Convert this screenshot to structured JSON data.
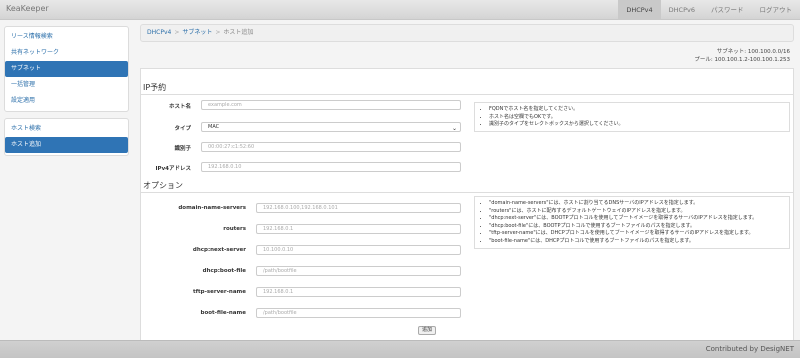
{
  "app": {
    "brand": "KeaKeeper"
  },
  "nav": {
    "items": [
      "DHCPv4",
      "DHCPv6",
      "パスワード",
      "ログアウト"
    ]
  },
  "sidebar": {
    "group1": [
      "リース情報検索",
      "共有ネットワーク",
      "サブネット",
      "一括管理",
      "設定適用"
    ],
    "group2": [
      "ホスト検索",
      "ホスト追加"
    ]
  },
  "breadcrumb": {
    "root": "DHCPv4",
    "level1": "サブネット",
    "current": "ホスト追加",
    "sep": ">"
  },
  "subnet_info": {
    "subnet": "サブネット: 100.100.0.0/16",
    "pool": "プール: 100.100.1.2-100.100.1.253"
  },
  "ip_reservation": {
    "title": "IP予約",
    "host_name": {
      "label": "ホスト名",
      "placeholder": "example.com"
    },
    "type": {
      "label": "タイプ",
      "value": "MAC"
    },
    "identifier": {
      "label": "識別子",
      "placeholder": "00:00:27:c1:52:60"
    },
    "ipv4": {
      "label": "IPv4アドレス",
      "placeholder": "192.168.0.10"
    },
    "help": [
      "FQDNでホスト名を指定してください。",
      "ホスト名は空欄でもOKです。",
      "識別子のタイプをセレクトボックスから選択してください。"
    ]
  },
  "options": {
    "title": "オプション",
    "fields": [
      {
        "label": "domain-name-servers",
        "placeholder": "192.168.0.100,192.168.0.101"
      },
      {
        "label": "routers",
        "placeholder": "192.168.0.1"
      },
      {
        "label": "dhcp:next-server",
        "placeholder": "10.100.0.10"
      },
      {
        "label": "dhcp:boot-file",
        "placeholder": "/path/bootfile"
      },
      {
        "label": "tftp-server-name",
        "placeholder": "192.168.0.1"
      },
      {
        "label": "boot-file-name",
        "placeholder": "/path/bootfile"
      }
    ],
    "help": [
      "\"domain-name-servers\"には、ホストに割り当てるDNSサーバのIPアドレスを指定します。",
      "\"routers\"には、ホストに配布するデフォルトゲートウェイのIPアドレスを指定します。",
      "\"dhcp:next-server\"には、BOOTPプロトコルを使用してブートイメージを取得するサーバのIPアドレスを指定します。",
      "\"dhcp:boot-file\"には、BOOTPプロトコルで使用するブートファイルのパスを指定します。",
      "\"tftp-server-name\"には、DHCPプロトコルを使用してブートイメージを取得するサーバのIPアドレスを指定します。",
      "\"boot-file-name\"には、DHCPプロトコルで使用するブートファイルのパスを指定します。"
    ]
  },
  "buttons": {
    "add": "追加"
  },
  "footer": {
    "text": "Contributed by DesigNET"
  }
}
